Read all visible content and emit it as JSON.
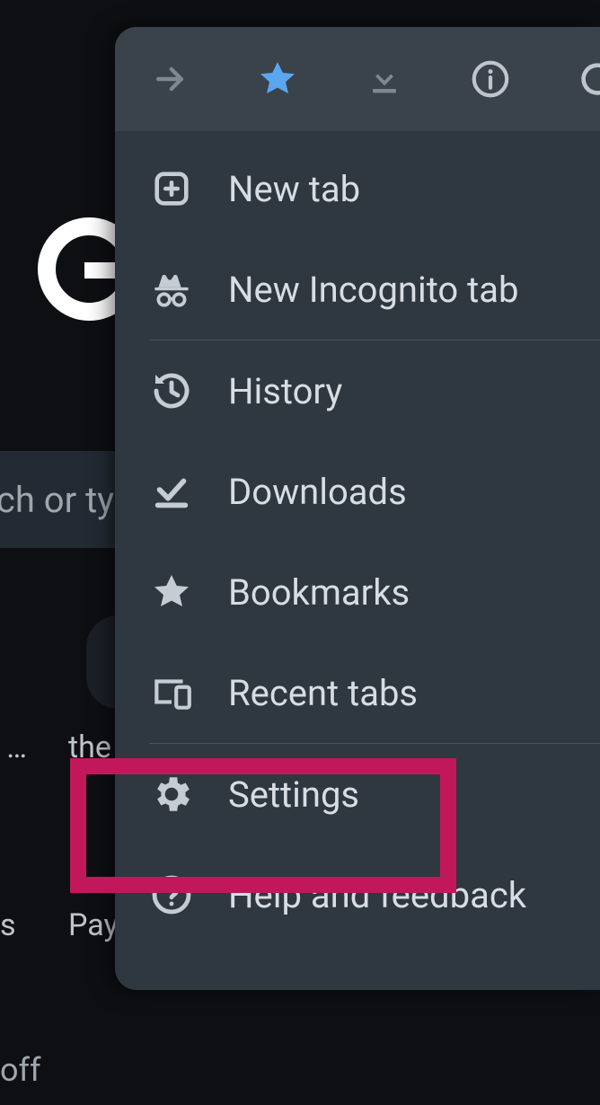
{
  "background": {
    "search_placeholder": "Search or type web address",
    "frag_dots": "…",
    "frag_the": "the",
    "frag_s": "s",
    "frag_pay": "Pay",
    "frag_off": "off"
  },
  "menu": {
    "items": [
      {
        "id": "new-tab",
        "label": "New tab"
      },
      {
        "id": "new-incognito",
        "label": "New Incognito tab"
      },
      {
        "id": "history",
        "label": "History"
      },
      {
        "id": "downloads",
        "label": "Downloads"
      },
      {
        "id": "bookmarks",
        "label": "Bookmarks"
      },
      {
        "id": "recent-tabs",
        "label": "Recent tabs"
      },
      {
        "id": "settings",
        "label": "Settings"
      },
      {
        "id": "help",
        "label": "Help and feedback"
      }
    ]
  }
}
